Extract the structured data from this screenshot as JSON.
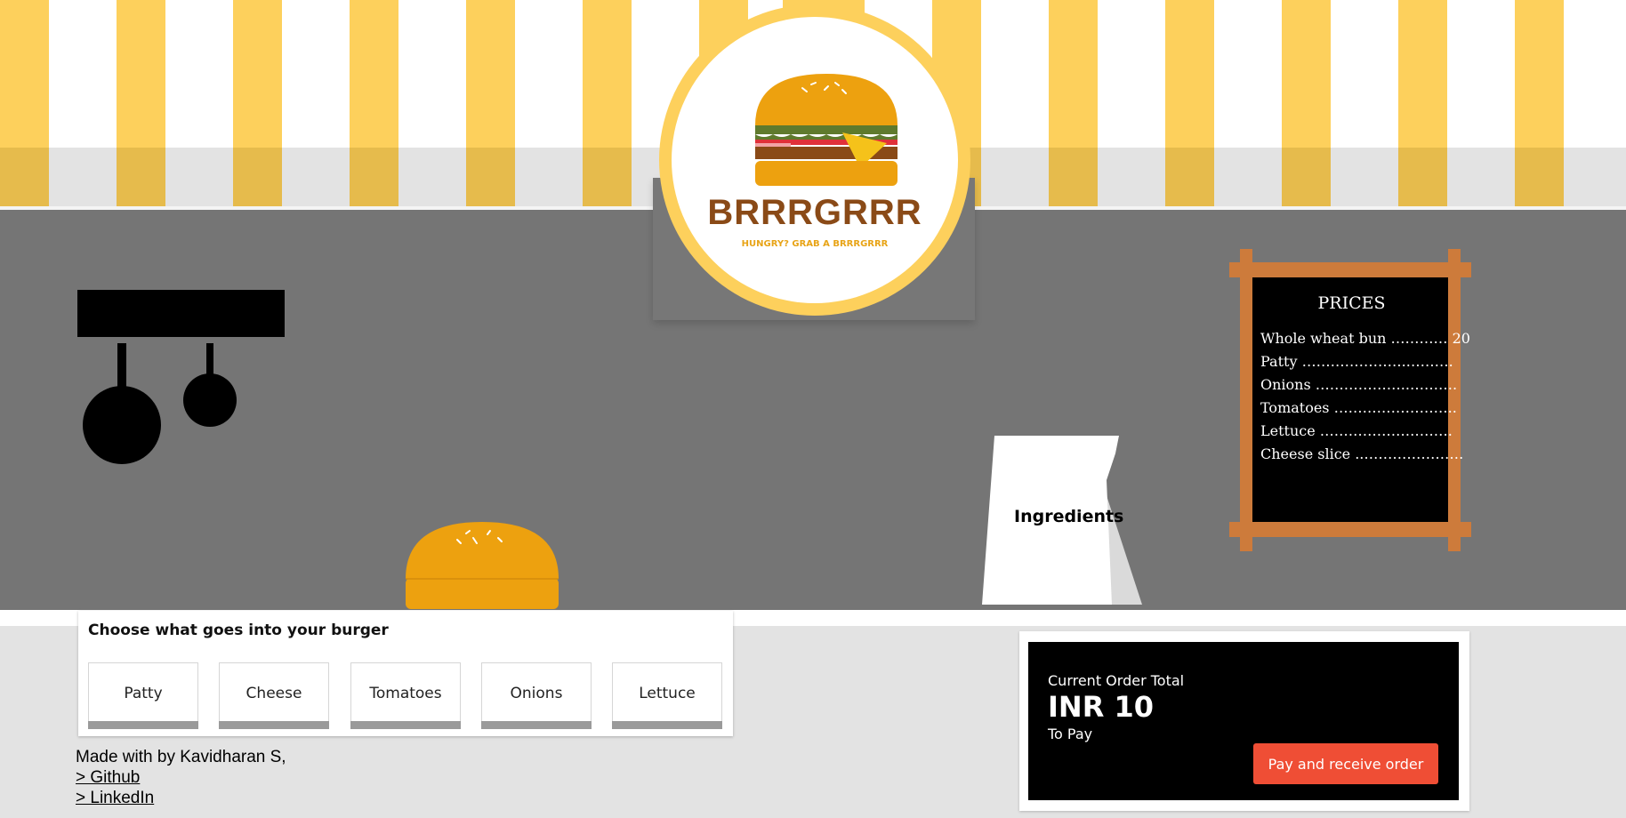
{
  "brand": {
    "name": "BRRRGRRR",
    "tagline": "HUNGRY? GRAB A BRRRGRRR"
  },
  "price_board": {
    "title": "PRICES",
    "items": [
      {
        "label": "Whole wheat bun …………",
        "price": "20"
      },
      {
        "label": "Patty ………………….……….",
        "price": ""
      },
      {
        "label": "Onions ………………..……….",
        "price": ""
      },
      {
        "label": "Tomatoes ……………………..",
        "price": ""
      },
      {
        "label": "Lettuce ……………………….",
        "price": ""
      },
      {
        "label": "Cheese slice ..…………………",
        "price": ""
      }
    ]
  },
  "ingredients_sign": {
    "label": "Ingredients"
  },
  "choose_panel": {
    "title": "Choose what goes into your burger",
    "buttons": [
      "Patty",
      "Cheese",
      "Tomatoes",
      "Onions",
      "Lettuce"
    ]
  },
  "footer": {
    "credit": "Made with by Kavidharan S,",
    "github": "> Github",
    "linkedin": "> LinkedIn"
  },
  "order": {
    "label": "Current Order Total",
    "amount": "INR 10",
    "sub": "To Pay",
    "pay_button": "Pay and receive order"
  },
  "colors": {
    "awning_yellow": "#fdd05c",
    "brand_brown": "#8a4a17",
    "bun_orange": "#eda10f",
    "pay_red": "#ef4e35"
  }
}
